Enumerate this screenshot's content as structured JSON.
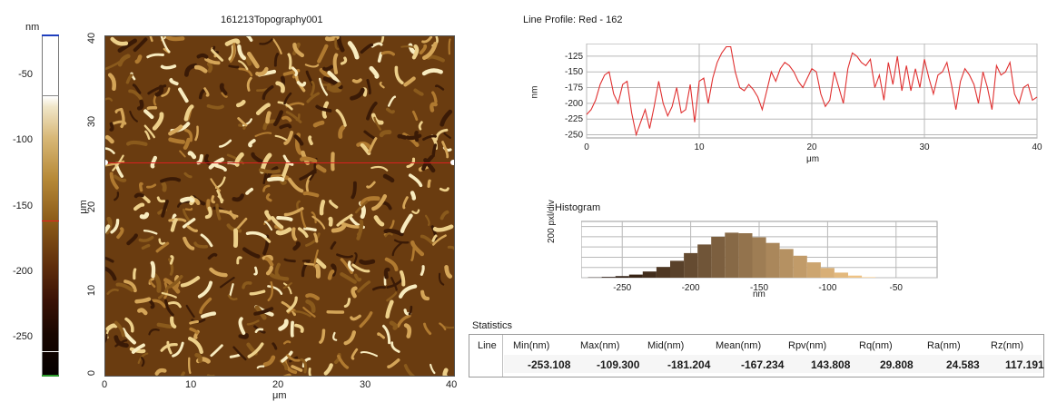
{
  "colorbar": {
    "unit": "nm",
    "labels": [
      "-50",
      "-100",
      "-150",
      "-200",
      "-250"
    ],
    "min": -280,
    "max": -30,
    "marker_value": -162
  },
  "topography": {
    "title": "161213Topography001",
    "xlabel": "μm",
    "ylabel": "μm",
    "xticks": [
      "0",
      "10",
      "20",
      "30",
      "40"
    ],
    "yticks": [
      "40",
      "30",
      "20",
      "10",
      "0"
    ],
    "profile_line_value_um": 25.5
  },
  "line_profile": {
    "title": "Line Profile: Red  -  162",
    "ylabel": "nm",
    "xlabel": "μm",
    "yticks": [
      "-125",
      "-150",
      "-175",
      "-200",
      "-225",
      "-250"
    ],
    "xticks": [
      "0",
      "10",
      "20",
      "30",
      "40"
    ]
  },
  "histogram": {
    "title": "Histogram",
    "ylabel": "200 pxl/div",
    "xlabel": "nm",
    "xticks": [
      "-250",
      "-200",
      "-150",
      "-100",
      "-50"
    ]
  },
  "statistics": {
    "title": "Statistics",
    "row_label": "Line",
    "headers": [
      "Min(nm)",
      "Max(nm)",
      "Mid(nm)",
      "Mean(nm)",
      "Rpv(nm)",
      "Rq(nm)",
      "Ra(nm)",
      "Rz(nm)"
    ],
    "values": [
      "-253.108",
      "-109.300",
      "-181.204",
      "-167.234",
      "143.808",
      "29.808",
      "24.583",
      "117.191"
    ]
  },
  "colors": {
    "profile_line": "#e03030",
    "profile_marker_line": "#d82020"
  },
  "chart_data": [
    {
      "type": "line",
      "title": "Line Profile: Red  -  162",
      "xlabel": "μm",
      "ylabel": "nm",
      "xlim": [
        0,
        40
      ],
      "ylim": [
        -255,
        -105
      ],
      "grid": true,
      "series": [
        {
          "x": [
            0,
            0.4,
            0.8,
            1.2,
            1.6,
            2.0,
            2.4,
            2.8,
            3.2,
            3.6,
            4.0,
            4.4,
            4.8,
            5.2,
            5.6,
            6.0,
            6.4,
            6.8,
            7.2,
            7.6,
            8.0,
            8.4,
            8.8,
            9.2,
            9.6,
            10.0,
            10.4,
            10.8,
            11.2,
            11.6,
            12.0,
            12.4,
            12.8,
            13.2,
            13.6,
            14.0,
            14.4,
            14.8,
            15.2,
            15.6,
            16.0,
            16.4,
            16.8,
            17.2,
            17.6,
            18.0,
            18.4,
            18.8,
            19.2,
            19.6,
            20.0,
            20.4,
            20.8,
            21.2,
            21.6,
            22.0,
            22.4,
            22.8,
            23.2,
            23.6,
            24.0,
            24.4,
            24.8,
            25.2,
            25.6,
            26.0,
            26.4,
            26.8,
            27.2,
            27.6,
            28.0,
            28.4,
            28.8,
            29.2,
            29.6,
            30.0,
            30.4,
            30.8,
            31.2,
            31.6,
            32.0,
            32.4,
            32.8,
            33.2,
            33.6,
            34.0,
            34.4,
            34.8,
            35.2,
            35.6,
            36.0,
            36.4,
            36.8,
            37.2,
            37.6,
            38.0,
            38.4,
            38.8,
            39.2,
            39.6,
            40.0
          ],
          "y": [
            -218,
            -210,
            -195,
            -170,
            -155,
            -150,
            -185,
            -200,
            -170,
            -165,
            -215,
            -250,
            -230,
            -210,
            -240,
            -205,
            -165,
            -200,
            -220,
            -205,
            -175,
            -215,
            -210,
            -170,
            -230,
            -165,
            -160,
            -200,
            -160,
            -135,
            -120,
            -110,
            -110,
            -150,
            -175,
            -180,
            -170,
            -178,
            -190,
            -210,
            -180,
            -150,
            -165,
            -145,
            -135,
            -140,
            -150,
            -165,
            -175,
            -160,
            -145,
            -150,
            -185,
            -205,
            -195,
            -150,
            -175,
            -200,
            -145,
            -120,
            -125,
            -135,
            -140,
            -130,
            -175,
            -155,
            -195,
            -135,
            -170,
            -125,
            -180,
            -140,
            -180,
            -145,
            -175,
            -130,
            -160,
            -185,
            -155,
            -150,
            -135,
            -170,
            -210,
            -165,
            -145,
            -155,
            -170,
            -200,
            -150,
            -175,
            -210,
            -140,
            -155,
            -150,
            -135,
            -185,
            -200,
            -175,
            -170,
            -195,
            -190
          ]
        }
      ]
    },
    {
      "type": "bar",
      "title": "Histogram",
      "xlabel": "nm",
      "ylabel": "200 pxl/div",
      "xlim": [
        -280,
        -20
      ],
      "ylim": [
        0,
        1100
      ],
      "categories": [
        "-270",
        "-260",
        "-250",
        "-240",
        "-230",
        "-220",
        "-210",
        "-200",
        "-190",
        "-180",
        "-170",
        "-160",
        "-150",
        "-140",
        "-130",
        "-120",
        "-110",
        "-100",
        "-90",
        "-80",
        "-70"
      ],
      "values": [
        5,
        15,
        30,
        60,
        120,
        210,
        330,
        480,
        650,
        800,
        880,
        870,
        790,
        680,
        560,
        430,
        300,
        190,
        100,
        40,
        10
      ]
    }
  ]
}
